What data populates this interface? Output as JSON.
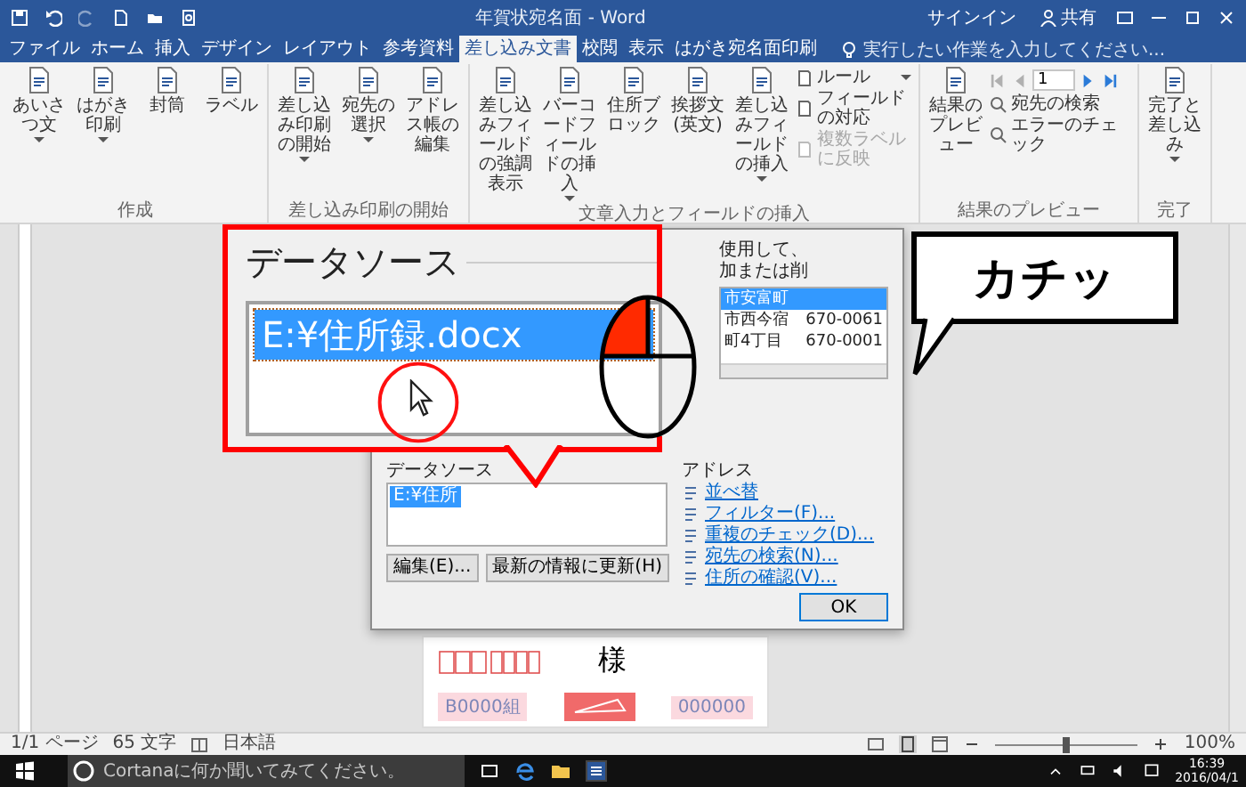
{
  "window": {
    "title": "年賀状宛名面 - Word"
  },
  "account": {
    "sign_in": "サインイン",
    "share": "共有"
  },
  "tabs": [
    {
      "label": "ファイル",
      "selected": false
    },
    {
      "label": "ホーム",
      "selected": false
    },
    {
      "label": "挿入",
      "selected": false
    },
    {
      "label": "デザイン",
      "selected": false
    },
    {
      "label": "レイアウト",
      "selected": false
    },
    {
      "label": "参考資料",
      "selected": false
    },
    {
      "label": "差し込み文書",
      "selected": true
    },
    {
      "label": "校閲",
      "selected": false
    },
    {
      "label": "表示",
      "selected": false
    },
    {
      "label": "はがき宛名面印刷",
      "selected": false
    }
  ],
  "tell_me": {
    "placeholder": "実行したい作業を入力してください..."
  },
  "ribbon": {
    "groups": [
      {
        "label": "作成",
        "items": [
          {
            "kind": "large",
            "label": "あいさつ文",
            "dropdown": true
          },
          {
            "kind": "large",
            "label": "はがき印刷",
            "dropdown": true
          },
          {
            "kind": "large",
            "label": "封筒",
            "dropdown": false
          },
          {
            "kind": "large",
            "label": "ラベル",
            "dropdown": false
          }
        ]
      },
      {
        "label": "差し込み印刷の開始",
        "items": [
          {
            "kind": "large",
            "label": "差し込み印刷の開始",
            "dropdown": true
          },
          {
            "kind": "large",
            "label": "宛先の選択",
            "dropdown": true
          },
          {
            "kind": "large",
            "label": "アドレス帳の編集",
            "dropdown": false
          }
        ]
      },
      {
        "label": "文章入力とフィールドの挿入",
        "items": [
          {
            "kind": "large",
            "label": "差し込みフィールドの強調表示",
            "dropdown": false
          },
          {
            "kind": "large",
            "label": "バーコードフィールドの挿入",
            "dropdown": true
          },
          {
            "kind": "large",
            "label": "住所ブロック",
            "dropdown": false
          },
          {
            "kind": "large",
            "label": "挨拶文(英文)",
            "dropdown": false
          },
          {
            "kind": "large",
            "label": "差し込みフィールドの挿入",
            "dropdown": true
          },
          {
            "kind": "stack",
            "entries": [
              {
                "label": "ルール",
                "dropdown": true,
                "disabled": false
              },
              {
                "label": "フィールドの対応",
                "dropdown": false,
                "disabled": false
              },
              {
                "label": "複数ラベルに反映",
                "dropdown": false,
                "disabled": true
              }
            ]
          }
        ]
      },
      {
        "label": "結果のプレビュー",
        "items": [
          {
            "kind": "large",
            "label": "結果のプレビュー",
            "dropdown": false
          },
          {
            "kind": "nav",
            "record": "1",
            "controls": [
              {
                "disabled": true
              },
              {
                "disabled": true
              },
              {
                "disabled": false
              },
              {
                "disabled": false
              }
            ],
            "entries": [
              {
                "label": "宛先の検索",
                "dropdown": false,
                "disabled": false
              },
              {
                "label": "エラーのチェック",
                "dropdown": false,
                "disabled": false
              }
            ]
          }
        ]
      },
      {
        "label": "完了",
        "items": [
          {
            "kind": "large",
            "label": "完了と差し込み",
            "dropdown": true
          }
        ]
      }
    ]
  },
  "dialog": {
    "intro": [
      "使用して、",
      "加または削"
    ],
    "recipients": [
      {
        "address": "市安富町",
        "selected": true
      },
      {
        "address": "市西今宿",
        "postal": "670-0061",
        "selected": false
      },
      {
        "address": "町4丁目",
        "postal": "670-0001",
        "selected": false
      }
    ],
    "data_source": {
      "label": "データソース",
      "items": [
        {
          "text": "E:¥住所",
          "selected": true
        }
      ]
    },
    "buttons": [
      "編集(E)...",
      "最新の情報に更新(H)"
    ],
    "address_label": "アドレス",
    "links": [
      "並べ替",
      "フィルター(F)...",
      "重複のチェック(D)...",
      "宛先の検索(N)...",
      "住所の確認(V)..."
    ],
    "ok": "OK"
  },
  "callout": {
    "heading": "データソース",
    "item": {
      "text": "E:¥住所録.docx",
      "selected": true
    }
  },
  "bubble": {
    "text": "カチッ"
  },
  "postcard": {
    "honorific": "様",
    "lottery_group": "B0000組",
    "lottery_number": "000000"
  },
  "status_bar": {
    "page": "1/1 ページ",
    "words": "65 文字",
    "language": "日本語",
    "zoom": {
      "level": 0.5
    },
    "zoom_text": "100%"
  },
  "taskbar": {
    "search_placeholder": "Cortanaに何か聞いてみてください。",
    "time": "16:39",
    "date": "2016/04/1"
  }
}
